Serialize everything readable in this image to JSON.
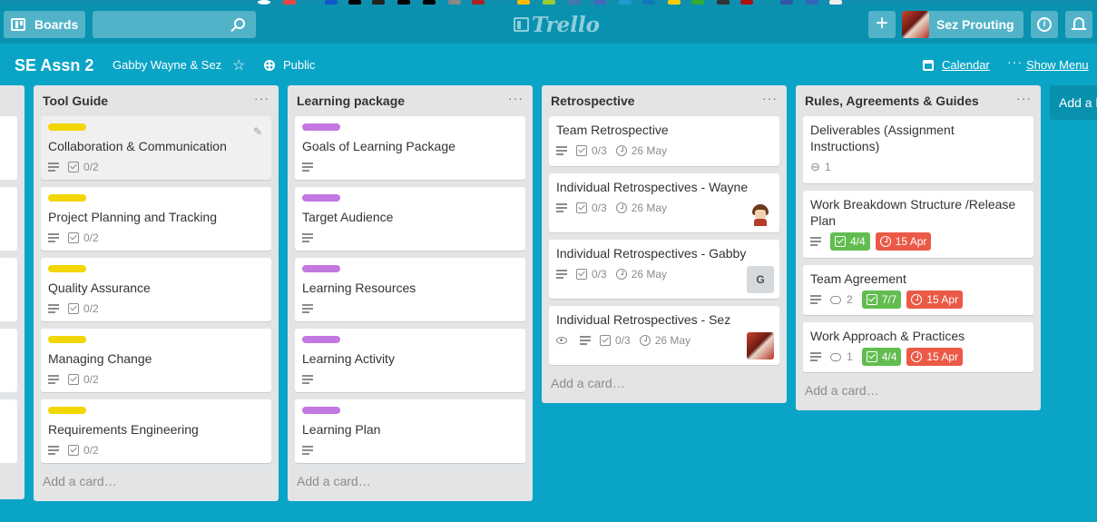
{
  "header": {
    "boards_label": "Boards",
    "search_placeholder": "",
    "logo_text": "Trello",
    "add_label": "+",
    "user_name": "Sez Prouting"
  },
  "board": {
    "title": "SE Assn 2",
    "team": "Gabby Wayne & Sez",
    "visibility": "Public",
    "calendar": "Calendar",
    "show_menu": "Show Menu"
  },
  "colors": {
    "background": "#0aa5c6",
    "label_yellow": "#f2d600",
    "label_purple": "#c377e0",
    "badge_green": "#61bd4f",
    "badge_red": "#eb5a46"
  },
  "lists": [
    {
      "title": "Tool Guide",
      "add_card": "Add a card…",
      "cards": [
        {
          "title": "Collaboration & Communication",
          "checklist": "0/2"
        },
        {
          "title": "Project Planning and Tracking",
          "checklist": "0/2"
        },
        {
          "title": "Quality Assurance",
          "checklist": "0/2"
        },
        {
          "title": "Managing Change",
          "checklist": "0/2"
        },
        {
          "title": "Requirements Engineering",
          "checklist": "0/2"
        }
      ]
    },
    {
      "title": "Learning package",
      "add_card": "Add a card…",
      "cards": [
        {
          "title": "Goals of Learning Package"
        },
        {
          "title": "Target Audience"
        },
        {
          "title": "Learning Resources"
        },
        {
          "title": "Learning Activity"
        },
        {
          "title": "Learning Plan"
        }
      ]
    },
    {
      "title": "Retrospective",
      "add_card": "Add a card…",
      "cards": [
        {
          "title": "Team Retrospective",
          "checklist": "0/3",
          "due": "26 May"
        },
        {
          "title": "Individual Retrospectives - Wayne",
          "checklist": "0/3",
          "due": "26 May"
        },
        {
          "title": "Individual Retrospectives - Gabby",
          "checklist": "0/3",
          "due": "26 May",
          "member_initial": "G"
        },
        {
          "title": "Individual Retrospectives - Sez",
          "checklist": "0/3",
          "due": "26 May"
        }
      ]
    },
    {
      "title": "Rules, Agreements & Guides",
      "add_card": "Add a card…",
      "cards": [
        {
          "title": "Deliverables (Assignment Instructions)",
          "attachments": "1"
        },
        {
          "title": "Work Breakdown Structure /Release Plan",
          "checklist": "4/4",
          "due": "15 Apr"
        },
        {
          "title": "Team Agreement",
          "comments": "2",
          "checklist": "7/7",
          "due": "15 Apr"
        },
        {
          "title": "Work Approach & Practices",
          "comments": "1",
          "checklist": "4/4",
          "due": "15 Apr"
        }
      ]
    }
  ],
  "add_list": "Add a list…"
}
